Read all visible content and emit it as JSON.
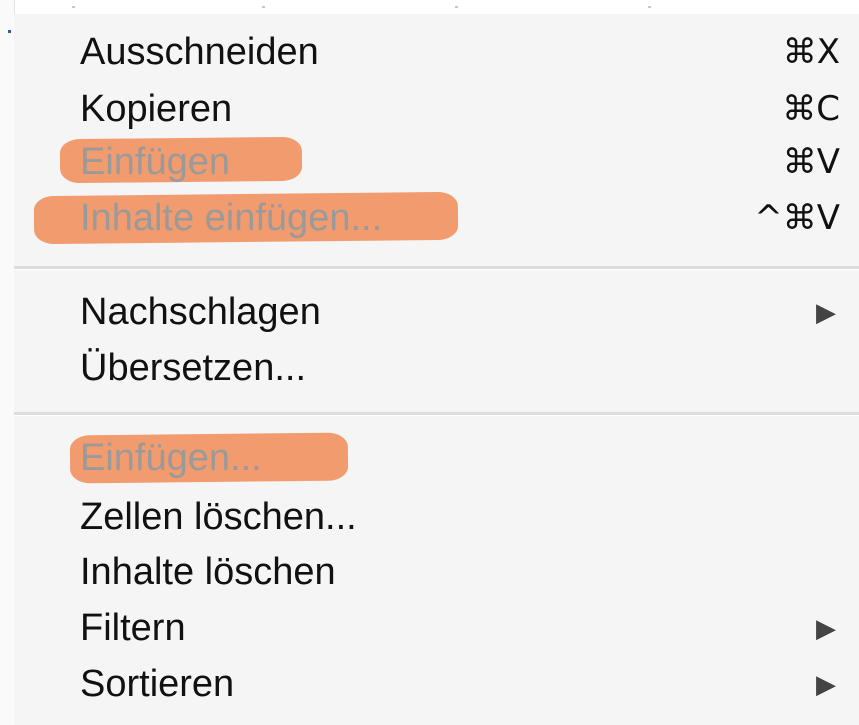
{
  "menu": {
    "group1": [
      {
        "label": "Ausschneiden",
        "shortcut": "⌘X",
        "enabled": true,
        "highlighted": false
      },
      {
        "label": "Kopieren",
        "shortcut": "⌘C",
        "enabled": true,
        "highlighted": false
      },
      {
        "label": "Einfügen",
        "shortcut": "⌘V",
        "enabled": false,
        "highlighted": true
      },
      {
        "label": "Inhalte einfügen...",
        "shortcut": "^⌘V",
        "enabled": false,
        "highlighted": true
      }
    ],
    "group2": [
      {
        "label": "Nachschlagen",
        "submenu": true,
        "arrow": "▶"
      },
      {
        "label": "Übersetzen...",
        "submenu": false
      }
    ],
    "group3": [
      {
        "label": "Einfügen...",
        "enabled": false,
        "highlighted": true
      },
      {
        "label": "Zellen löschen...",
        "enabled": true
      },
      {
        "label": "Inhalte löschen",
        "enabled": true
      },
      {
        "label": "Filtern",
        "submenu": true,
        "arrow": "▶"
      },
      {
        "label": "Sortieren",
        "submenu": true,
        "arrow": "▶"
      }
    ]
  },
  "colors": {
    "highlight": "#f0783c",
    "disabled_text": "#9a9a9a",
    "menu_background": "#f5f5f5"
  }
}
